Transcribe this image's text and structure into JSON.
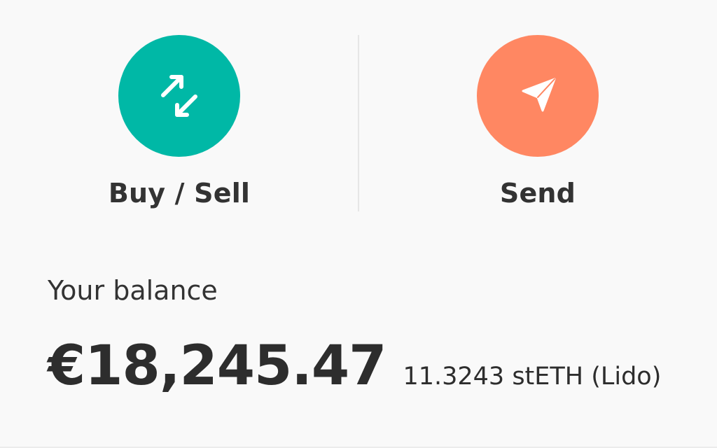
{
  "actions": {
    "buy_sell": {
      "label": "Buy / Sell",
      "icon": "swap-arrows-icon",
      "color": "#00b8a6"
    },
    "send": {
      "label": "Send",
      "icon": "paper-plane-icon",
      "color": "#ff8762"
    }
  },
  "balance": {
    "title": "Your balance",
    "fiat_amount": "€18,245.47",
    "crypto_amount": "11.3243 stETH (Lido)"
  }
}
